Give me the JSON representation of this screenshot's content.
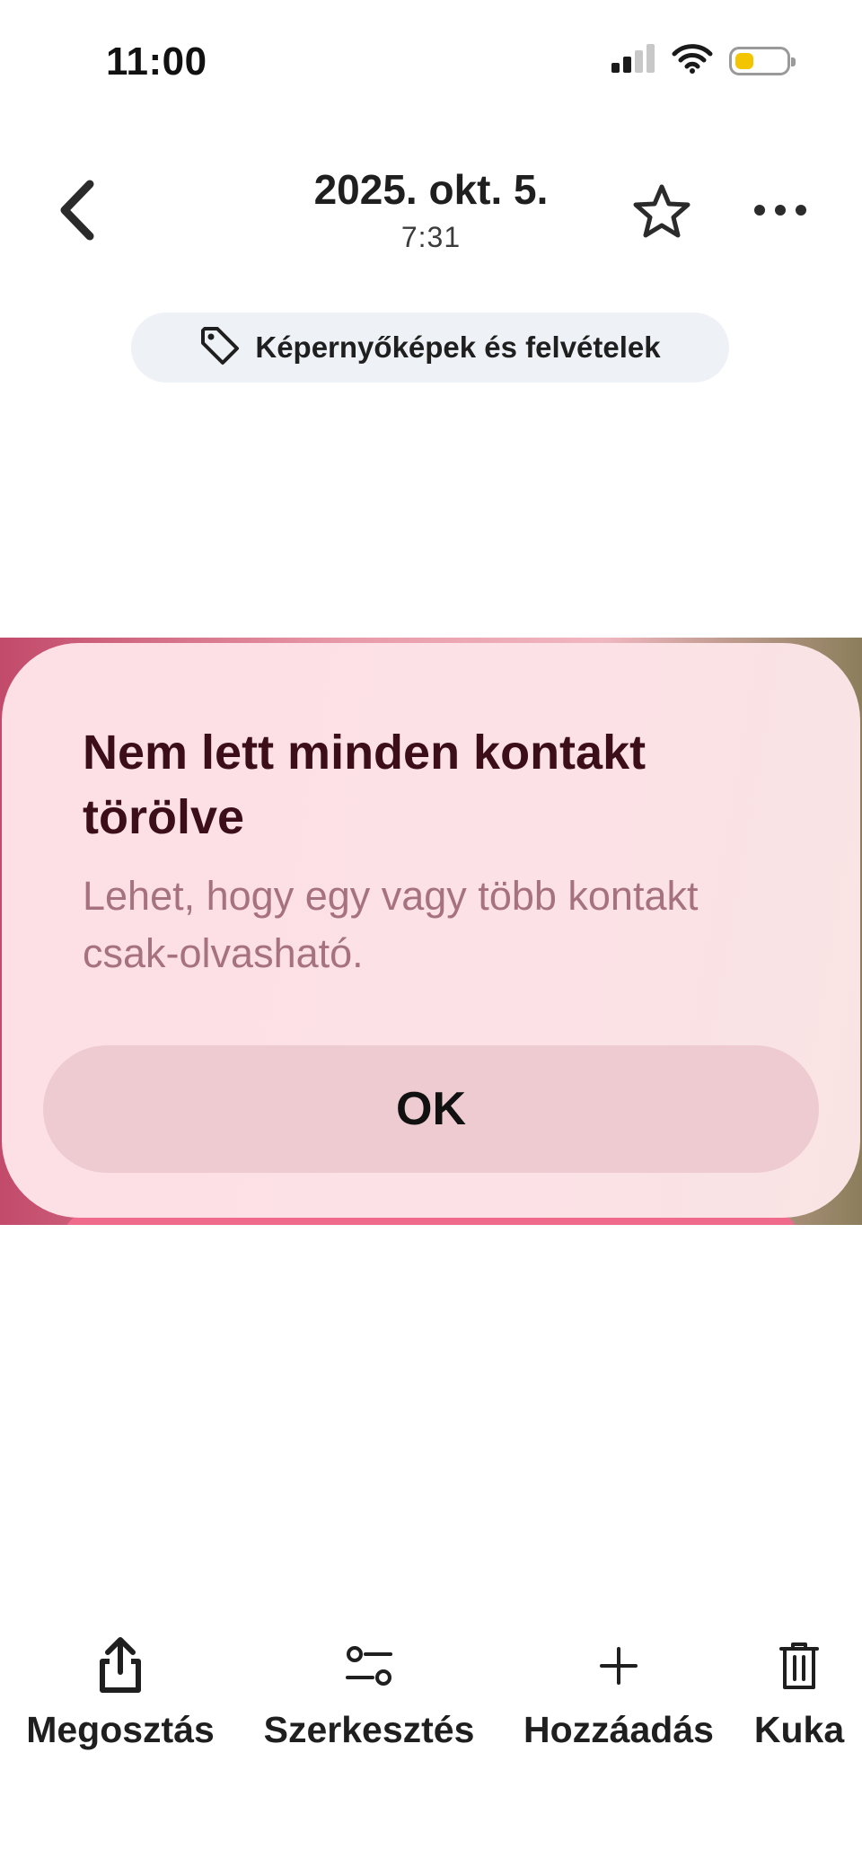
{
  "status_bar": {
    "time": "11:00",
    "battery_level": 0.35,
    "battery_color": "#f3c400"
  },
  "header": {
    "date": "2025. okt. 5.",
    "time": "7:31",
    "back_icon": "chevron-left-icon",
    "favorite_icon": "star-outline-icon",
    "more_icon": "more-horizontal-icon"
  },
  "chip": {
    "icon": "tag-icon",
    "label": "Képernyőképek és felvételek"
  },
  "screenshot": {
    "alert": {
      "title": "Nem lett minden kontakt törölve",
      "message": "Lehet, hogy egy vagy több kontakt csak-olvasható.",
      "ok_label": "OK"
    }
  },
  "toolbar": {
    "items": [
      {
        "label": "Megosztás",
        "icon": "share-icon"
      },
      {
        "label": "Szerkesztés",
        "icon": "edit-sliders-icon"
      },
      {
        "label": "Hozzáadás",
        "icon": "plus-icon"
      },
      {
        "label": "Kuka",
        "icon": "trash-icon"
      }
    ]
  },
  "colors": {
    "alert_title": "#3b0e1a",
    "alert_message": "#a7727f",
    "chip_background": "#eef2f6"
  }
}
